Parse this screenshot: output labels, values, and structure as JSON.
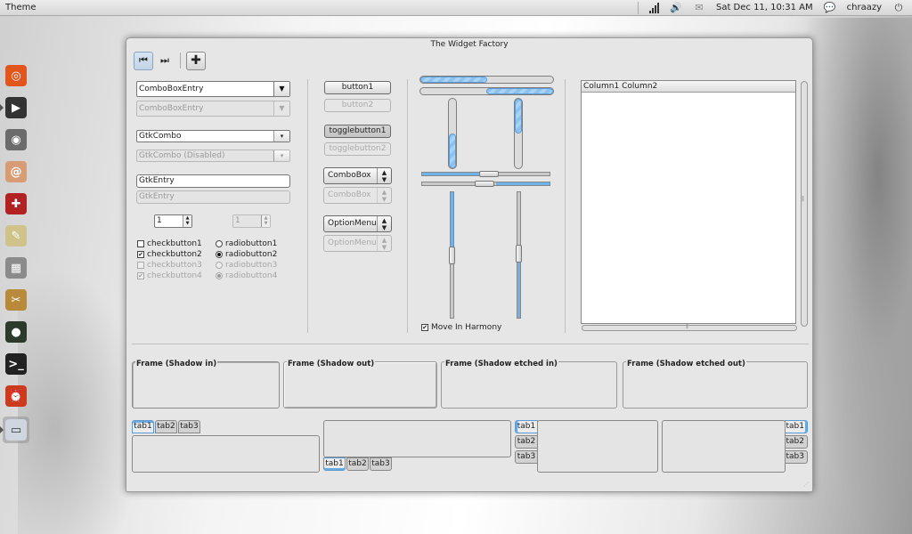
{
  "panel": {
    "app_title": "Theme",
    "clock": "Sat Dec 11, 10:31 AM",
    "user": "chraazy"
  },
  "launcher": {
    "items": [
      {
        "icon": "ubuntu-software-icon",
        "color": "#e2561e",
        "glyph": "◎"
      },
      {
        "icon": "media-player-icon",
        "color": "#333333",
        "glyph": "▶"
      },
      {
        "icon": "speaker-icon",
        "color": "#6b6b6b",
        "glyph": "◉"
      },
      {
        "icon": "shell-icon",
        "color": "#d79c74",
        "glyph": "@"
      },
      {
        "icon": "workspace-switcher-icon",
        "color": "#b22222",
        "glyph": "✚"
      },
      {
        "icon": "text-editor-icon",
        "color": "#cfc38a",
        "glyph": "✎"
      },
      {
        "icon": "calculator-icon",
        "color": "#8b8b8b",
        "glyph": "▦"
      },
      {
        "icon": "archive-icon",
        "color": "#b88a3a",
        "glyph": "✂"
      },
      {
        "icon": "globe-icon",
        "color": "#2b3a2b",
        "glyph": "●"
      },
      {
        "icon": "terminal-icon",
        "color": "#222222",
        "glyph": ">_"
      },
      {
        "icon": "alarm-clock-icon",
        "color": "#cc3b1e",
        "glyph": "⏰"
      },
      {
        "icon": "window-icon",
        "color": "#cfd6e0",
        "glyph": "▭"
      }
    ]
  },
  "window": {
    "title": "The Widget Factory",
    "toolbar": {
      "back_icon": "⏮",
      "forward_icon": "⏭",
      "add_icon": "✚"
    }
  },
  "left_column": {
    "combo_box_entry": "ComboBoxEntry",
    "combo_box_entry_disabled": "ComboBoxEntry",
    "gtk_combo": "GtkCombo",
    "gtk_combo_disabled": "GtkCombo (Disabled)",
    "entry": "GtkEntry",
    "entry_disabled": "GtkEntry",
    "spin_value": "1",
    "spin_value_disabled": "1",
    "checks": [
      {
        "label": "checkbutton1",
        "checked": false,
        "disabled": false
      },
      {
        "label": "checkbutton2",
        "checked": true,
        "disabled": false
      },
      {
        "label": "checkbutton3",
        "checked": false,
        "disabled": true
      },
      {
        "label": "checkbutton4",
        "checked": true,
        "disabled": true
      }
    ],
    "radios": [
      {
        "label": "radiobutton1",
        "selected": false,
        "disabled": false
      },
      {
        "label": "radiobutton2",
        "selected": true,
        "disabled": false
      },
      {
        "label": "radiobutton3",
        "selected": false,
        "disabled": true
      },
      {
        "label": "radiobutton4",
        "selected": true,
        "disabled": true
      }
    ]
  },
  "buttons": {
    "button1": "button1",
    "button2": "button2",
    "togglebutton1": "togglebutton1",
    "togglebutton2": "togglebutton2",
    "combobox": "ComboBox",
    "combobox_disabled": "ComboBox",
    "optionmenu": "OptionMenu",
    "optionmenu_disabled": "OptionMenu"
  },
  "ranges": {
    "progress_h1": 0.5,
    "progress_h2": 0.5,
    "progress_v1": 0.5,
    "progress_v2": 0.5,
    "move_in_harmony": "Move In Harmony",
    "accent": "#6fb2ea"
  },
  "treeview": {
    "columns": [
      "Column1",
      "Column2"
    ]
  },
  "frames": [
    "Frame (Shadow in)",
    "Frame (Shadow out)",
    "Frame (Shadow etched in)",
    "Frame (Shadow etched out)"
  ],
  "notebooks": {
    "tabs": [
      "tab1",
      "tab2",
      "tab3"
    ]
  }
}
